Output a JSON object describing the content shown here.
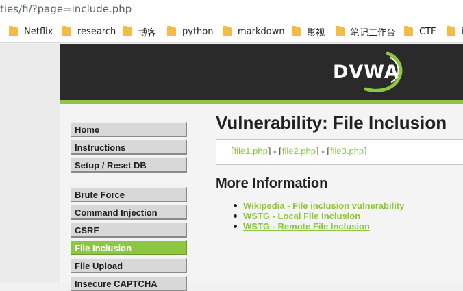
{
  "browser": {
    "url_fragment": "ties/fi/?page=include.php",
    "bookmarks": [
      "Netflix",
      "research",
      "博客",
      "python",
      "markdown",
      "影视",
      "笔记工作台",
      "CTF",
      "i"
    ]
  },
  "header": {
    "logo_text": "DVWA"
  },
  "sidebar": {
    "items": [
      {
        "label": "Home",
        "active": false
      },
      {
        "label": "Instructions",
        "active": false
      },
      {
        "label": "Setup / Reset DB",
        "active": false
      },
      {
        "label": "Brute Force",
        "active": false
      },
      {
        "label": "Command Injection",
        "active": false
      },
      {
        "label": "CSRF",
        "active": false
      },
      {
        "label": "File Inclusion",
        "active": true
      },
      {
        "label": "File Upload",
        "active": false
      },
      {
        "label": "Insecure CAPTCHA",
        "active": false
      }
    ]
  },
  "main": {
    "title": "Vulnerability: File Inclusion",
    "files": {
      "open_bracket": "[",
      "file1": "file1.php",
      "sep1": "] - [",
      "file2": "file2.php",
      "sep2": "] - [",
      "file3": "file3.php",
      "close_bracket": "]"
    },
    "more_info_heading": "More Information",
    "links": [
      "Wikipedia - File inclusion vulnerability",
      "WSTG - Local File Inclusion",
      "WSTG - Remote File Inclusion"
    ]
  },
  "colors": {
    "accent": "#8dc63f",
    "header_bg": "#2a2a2a",
    "folder": "#f2bd42"
  }
}
